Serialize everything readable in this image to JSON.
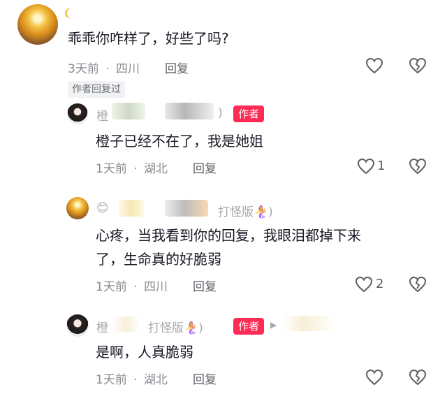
{
  "comments": [
    {
      "text": "乖乖你咋样了，好些了吗?",
      "time": "3天前",
      "location": "四川",
      "reply_label": "回复",
      "like_count": "",
      "author_replied_tag": "作者回复过"
    },
    {
      "name_partial": "橙",
      "name_suffix": ")",
      "author_badge": "作者",
      "text": "橙子已经不在了，我是她姐",
      "time": "1天前",
      "location": "湖北",
      "reply_label": "回复",
      "like_count": "1"
    },
    {
      "name_emoji": "😊",
      "name_suffix": "打怪版🧜‍♀️)",
      "text_line1": "心疼，当我看到你的回复，我眼泪都掉下来",
      "text_line2": "了，生命真的好脆弱",
      "time": "1天前",
      "location": "四川",
      "reply_label": "回复",
      "like_count": "2"
    },
    {
      "name_partial": "橙",
      "name_suffix": "打怪版🧜‍♀️)",
      "author_badge": "作者",
      "reply_arrow": "▶",
      "text": "是啊，人真脆弱",
      "time": "1天前",
      "location": "湖北",
      "reply_label": "回复",
      "like_count": ""
    }
  ],
  "separator": "·",
  "colors": {
    "accent": "#fe2c55",
    "meta": "#8a8b91"
  }
}
